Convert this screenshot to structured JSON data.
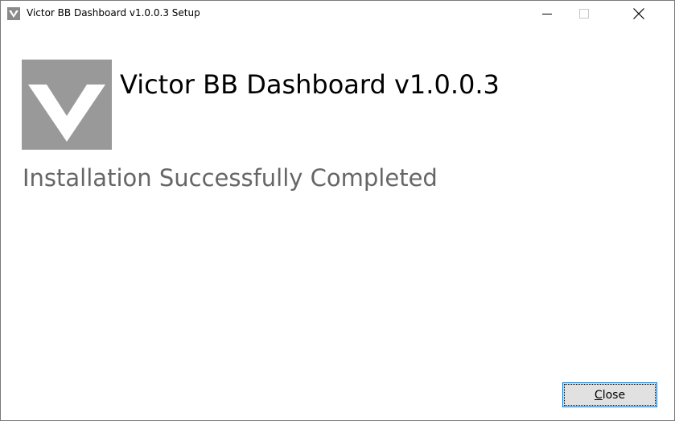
{
  "window": {
    "title": "Victor BB Dashboard v1.0.0.3 Setup",
    "controls": [
      "minimize-icon",
      "maximize-icon",
      "close-icon"
    ]
  },
  "header": {
    "product_title": "Victor BB Dashboard v1.0.0.3",
    "logo_icon": "victor-v-logo-icon"
  },
  "main": {
    "status": "Installation Successfully Completed"
  },
  "footer": {
    "close_button": {
      "mnemonic": "C",
      "rest": "lose"
    }
  },
  "colors": {
    "logo_bg": "#999999",
    "status_text": "#666666",
    "button_border": "#0078d7",
    "button_bg": "#e1e1e1"
  }
}
